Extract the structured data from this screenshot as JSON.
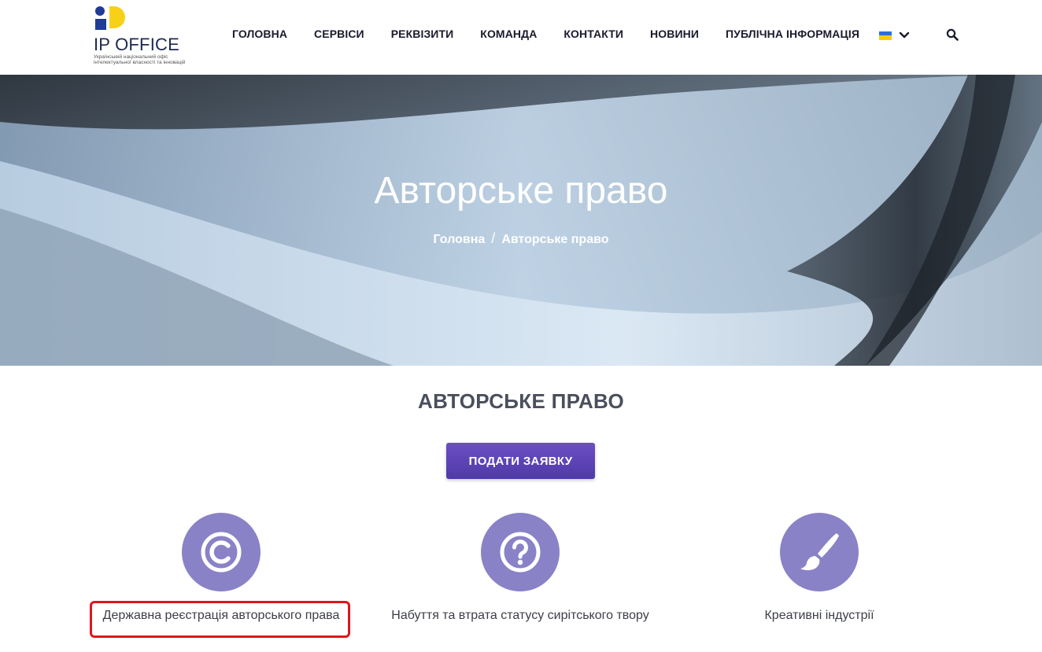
{
  "header": {
    "logo_text": "IP OFFICE",
    "logo_subtitle": "Український національний офіс інтелектуальної власності та інновацій",
    "nav": [
      {
        "label": "ГОЛОВНА"
      },
      {
        "label": "СЕРВІСИ"
      },
      {
        "label": "РЕКВІЗИТИ"
      },
      {
        "label": "КОМАНДА"
      },
      {
        "label": "КОНТАКТИ"
      },
      {
        "label": "НОВИНИ"
      },
      {
        "label": "ПУБЛІЧНА ІНФОРМАЦІЯ"
      }
    ],
    "language_icon": "ukraine-flag-icon",
    "search_icon": "search-icon"
  },
  "hero": {
    "title": "Авторське право",
    "breadcrumb": {
      "home": "Головна",
      "separator": "/",
      "current": "Авторське право"
    }
  },
  "main": {
    "section_title": "АВТОРСЬКЕ ПРАВО",
    "apply_button": "ПОДАТИ ЗАЯВКУ",
    "cards": [
      {
        "label": "Державна реєстрація авторського права",
        "icon": "copyright-icon"
      },
      {
        "label": "Набуття та втрата статусу сирітського твору",
        "icon": "question-icon"
      },
      {
        "label": "Креативні індустрії",
        "icon": "paintbrush-icon"
      }
    ]
  },
  "colors": {
    "accent": "#8a82c7",
    "button": "#5a43b3",
    "highlight": "#e0161c",
    "logo_blue": "#1f3d96",
    "logo_yellow": "#f7d117"
  }
}
